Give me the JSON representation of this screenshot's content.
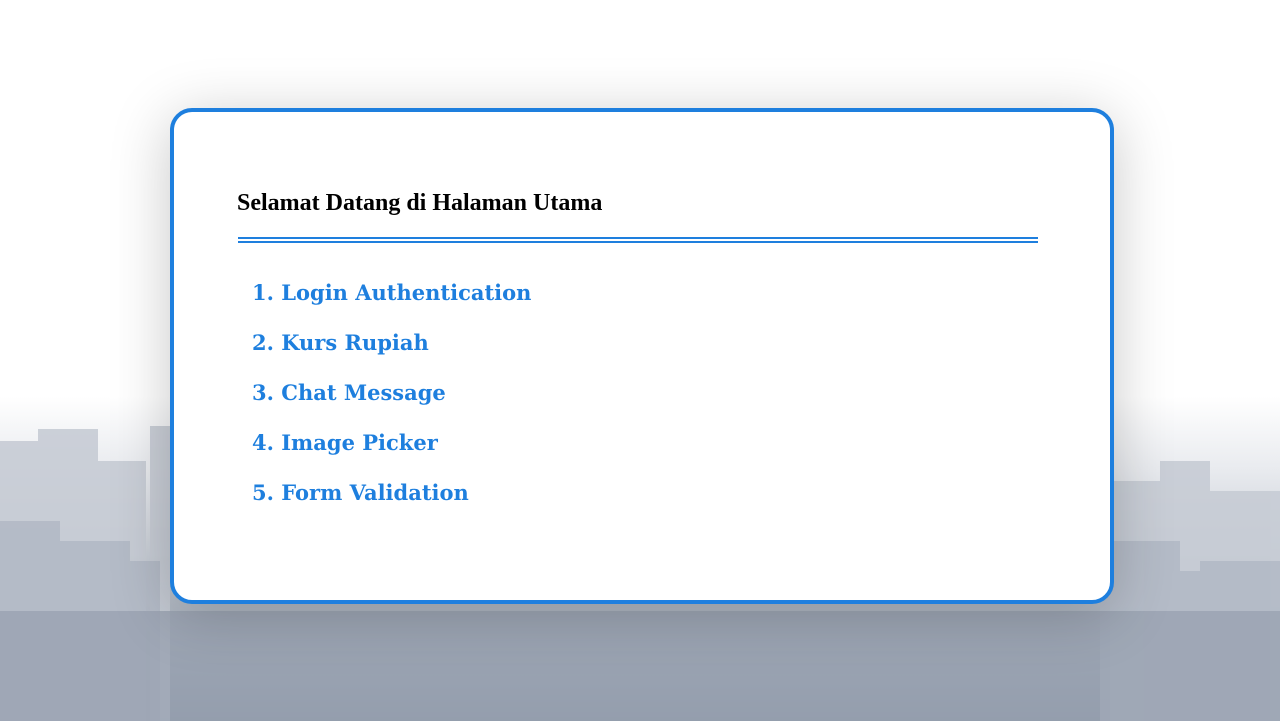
{
  "card": {
    "title": "Selamat Datang di Halaman Utama"
  },
  "menu": [
    {
      "label": "1. Login Authentication"
    },
    {
      "label": "2. Kurs Rupiah"
    },
    {
      "label": "3. Chat Message"
    },
    {
      "label": "4. Image Picker"
    },
    {
      "label": "5. Form Validation"
    }
  ],
  "colors": {
    "accent": "#1e7fde",
    "title": "#000000",
    "card_background": "#ffffff"
  }
}
